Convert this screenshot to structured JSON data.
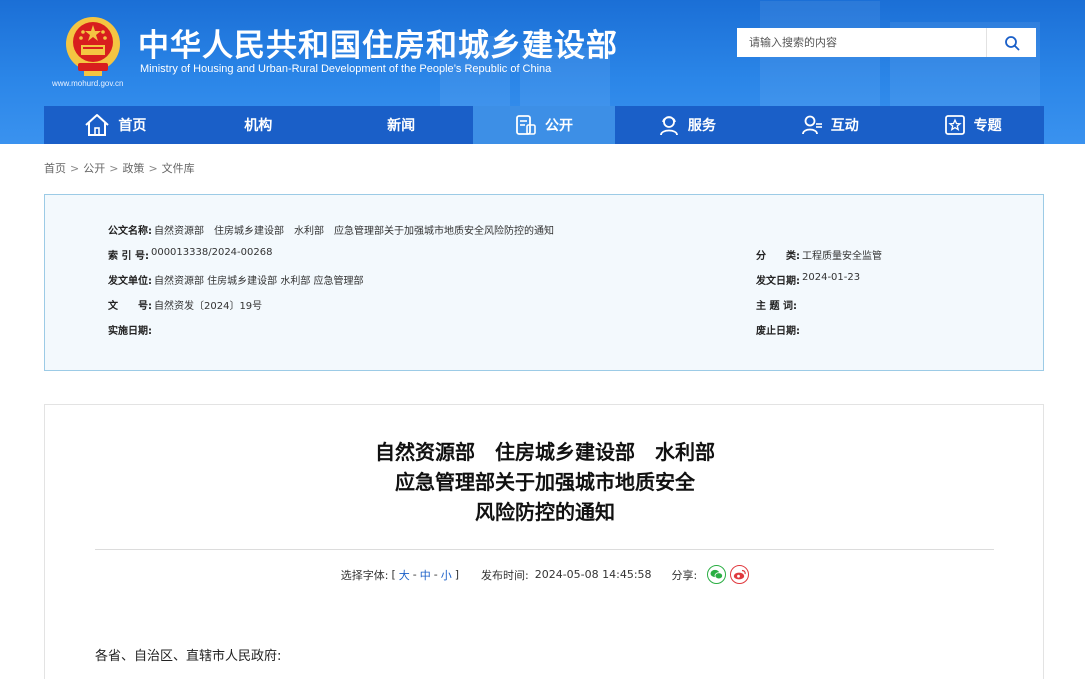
{
  "header": {
    "title": "中华人民共和国住房和城乡建设部",
    "subtitle": "Ministry of Housing and Urban-Rural Development of the People’s Republic of China",
    "url": "www.mohurd.gov.cn",
    "search_placeholder": "请输入搜索的内容"
  },
  "nav": {
    "items": [
      {
        "label": "首页",
        "icon": "home-icon"
      },
      {
        "label": "机构",
        "icon": ""
      },
      {
        "label": "新闻",
        "icon": ""
      },
      {
        "label": "公开",
        "icon": "document-icon"
      },
      {
        "label": "服务",
        "icon": "service-user-icon"
      },
      {
        "label": "互动",
        "icon": "interact-user-icon"
      },
      {
        "label": "专题",
        "icon": "star-board-icon"
      }
    ],
    "active_index": 3
  },
  "breadcrumb": [
    "首页",
    "公开",
    "政策",
    "文件库"
  ],
  "meta": {
    "doc_name_label": "公文名称:",
    "doc_name": "自然资源部　住房城乡建设部　水利部　应急管理部关于加强城市地质安全风险防控的通知",
    "index_label": "索 引 号:",
    "index": "000013338/2024-00268",
    "category_label": "分　　类:",
    "category": "工程质量安全监管",
    "issuer_label": "发文单位:",
    "issuer": "自然资源部 住房城乡建设部 水利部 应急管理部",
    "issue_date_label": "发文日期:",
    "issue_date": "2024-01-23",
    "doc_no_label": "文　　号:",
    "doc_no": "自然资发〔2024〕19号",
    "keywords_label": "主 题 词:",
    "keywords": "",
    "effective_label": "实施日期:",
    "effective": "",
    "expiry_label": "废止日期:",
    "expiry": ""
  },
  "article": {
    "title_lines": [
      "自然资源部　住房城乡建设部　水利部",
      "应急管理部关于加强城市地质安全",
      "风险防控的通知"
    ],
    "font_label": "选择字体:",
    "font_open": "[",
    "font_large": "大",
    "font_medium": "中",
    "font_small": "小",
    "font_close": "]",
    "font_sep": "-",
    "publish_label": "发布时间:",
    "publish_time": "2024-05-08 14:45:58",
    "share_label": "分享:",
    "salutation": "各省、自治区、直辖市人民政府:"
  },
  "colors": {
    "header_blue": "#2b86e8",
    "nav_blue": "#1a5fc8",
    "nav_active": "#3d8fe6",
    "meta_bg": "#f3f9fd",
    "meta_border": "#9ccbe6",
    "wechat_green": "#2aae43",
    "weibo_red": "#e0393e"
  }
}
